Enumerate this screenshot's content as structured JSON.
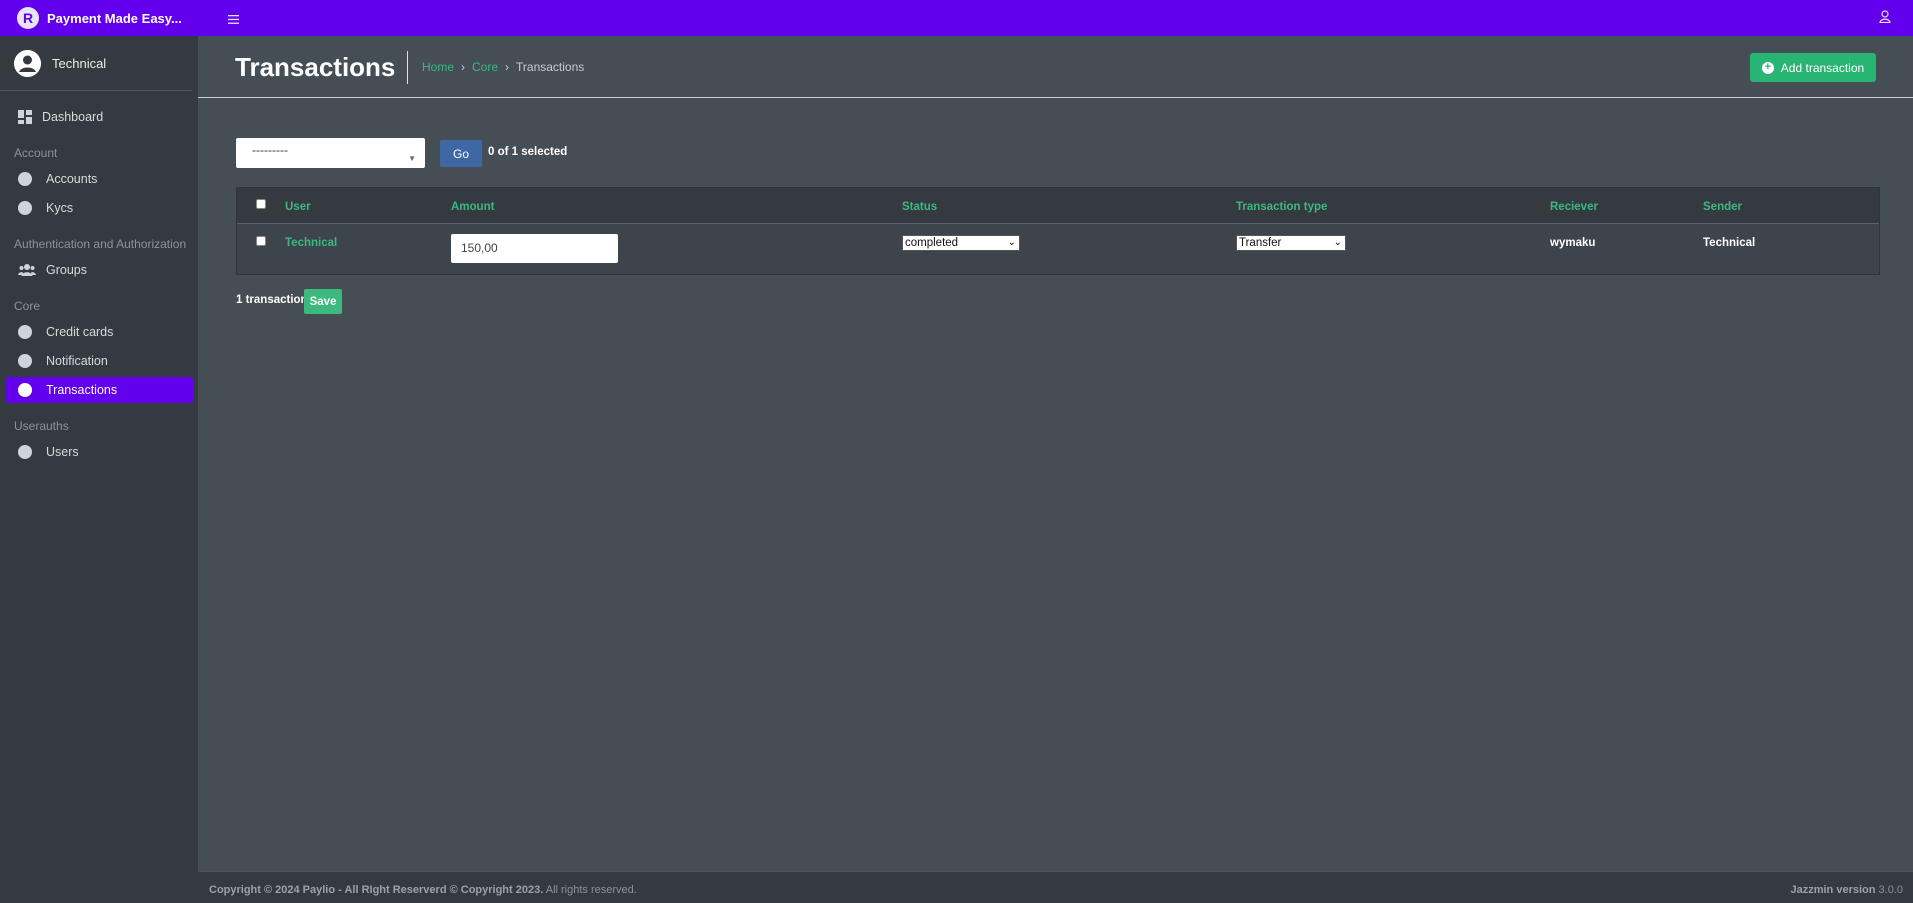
{
  "brand": {
    "logo_letter": "R",
    "name": "Payment Made Easy..."
  },
  "user": {
    "name": "Technical"
  },
  "sidebar": {
    "dashboard": "Dashboard",
    "sections": [
      {
        "header": "Account",
        "items": [
          "Accounts",
          "Kycs"
        ]
      },
      {
        "header": "Authentication and Authorization",
        "items": [
          "Groups"
        ]
      },
      {
        "header": "Core",
        "items": [
          "Credit cards",
          "Notification",
          "Transactions"
        ]
      },
      {
        "header": "Userauths",
        "items": [
          "Users"
        ]
      }
    ],
    "active_item": "Transactions"
  },
  "header": {
    "title": "Transactions",
    "breadcrumb": [
      "Home",
      "Core",
      "Transactions"
    ],
    "breadcrumb_sep": "›",
    "add_button": "Add transaction"
  },
  "actions": {
    "select_value": "---------",
    "go_label": "Go",
    "selected_text": "0 of 1 selected"
  },
  "table": {
    "columns": [
      "User",
      "Amount",
      "Status",
      "Transaction type",
      "Reciever",
      "Sender"
    ],
    "rows": [
      {
        "user": "Technical",
        "amount": "150,00",
        "status": "completed",
        "transaction_type": "Transfer",
        "receiver": "wymaku",
        "sender": "Technical"
      }
    ]
  },
  "footer_actions": {
    "count_text": "1 transaction",
    "save_label": "Save"
  },
  "footer": {
    "copyright_bold": "Copyright © 2024 Paylio - All RIght Reserverd © Copyright 2023.",
    "copyright_rest": " All rights reserved.",
    "version_bold": "Jazzmin version",
    "version_num": " 3.0.0"
  },
  "colors": {
    "accent": "#6200ee",
    "success": "#28b472",
    "link": "#3bb97f",
    "primary": "#3e68a4"
  }
}
